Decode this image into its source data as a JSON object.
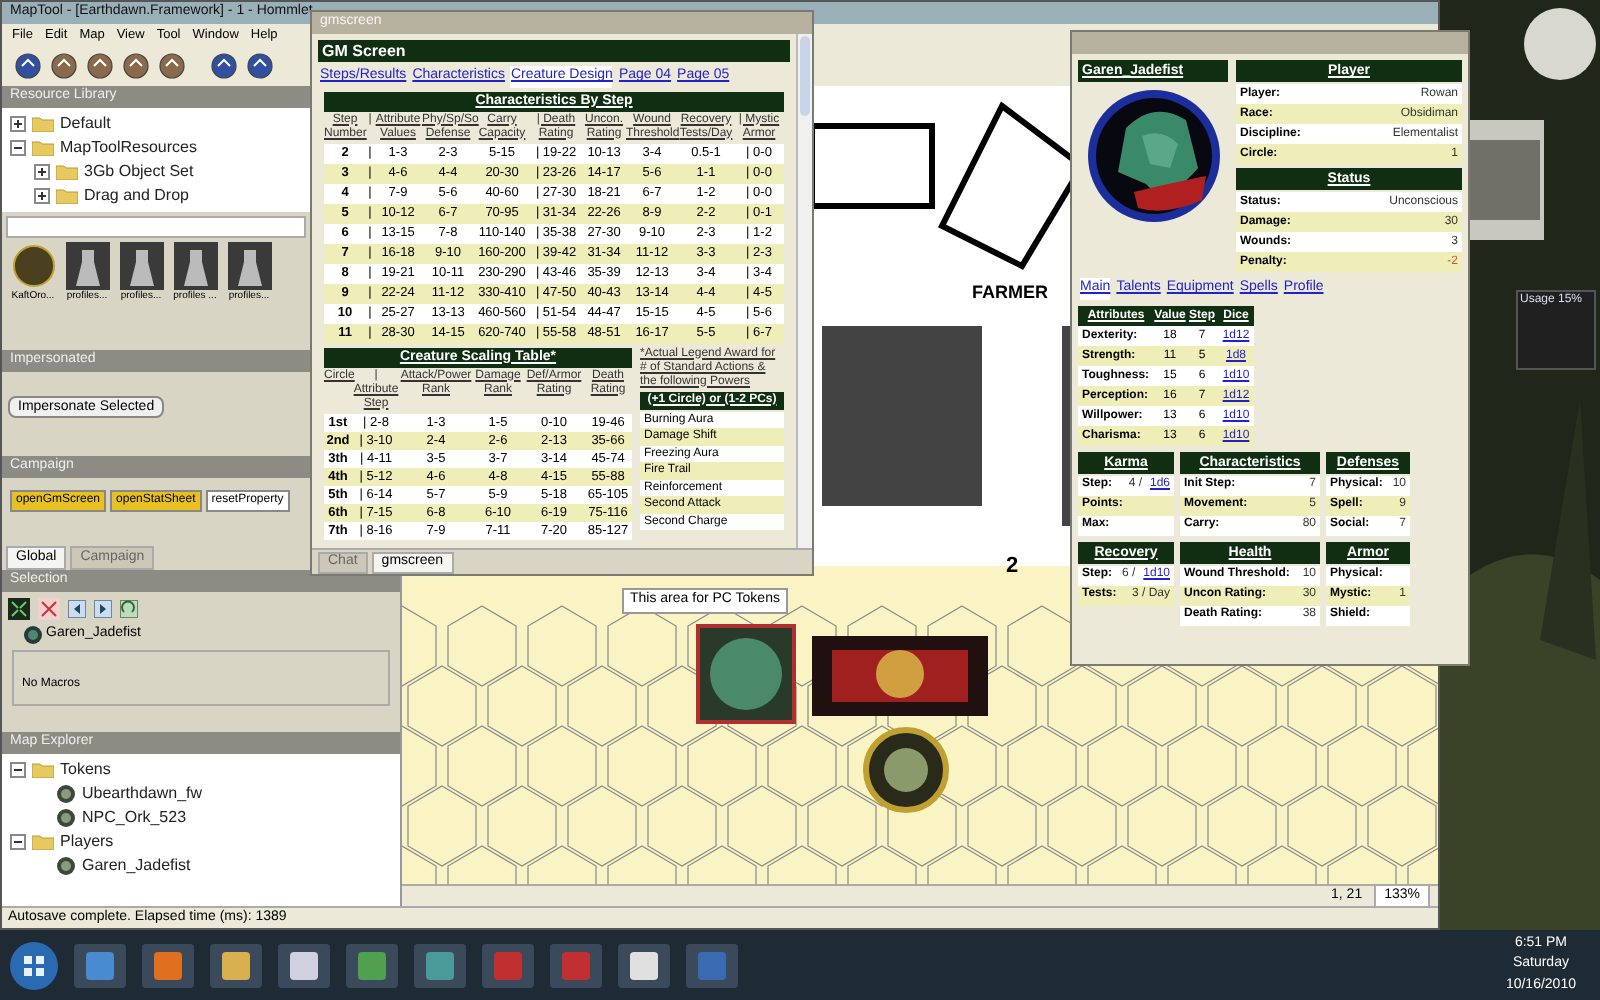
{
  "main_window": {
    "title": "MapTool - [Earthdawn.Framework] - 1 - Hommlet",
    "menu": [
      "File",
      "Edit",
      "Map",
      "View",
      "Tool",
      "Window",
      "Help"
    ]
  },
  "resource_library": {
    "title": "Resource Library",
    "tree": [
      {
        "label": "Default",
        "expanded": false
      },
      {
        "label": "MapToolResources",
        "expanded": true,
        "children": [
          {
            "label": "3Gb Object Set",
            "expanded": false
          },
          {
            "label": "Drag and Drop",
            "expanded": false
          }
        ]
      }
    ],
    "thumbnails": [
      "KaftOro...",
      "profiles...",
      "profiles...",
      "profiles ...",
      "profiles..."
    ]
  },
  "impersonated": {
    "title": "Impersonated",
    "button": "Impersonate Selected"
  },
  "campaign": {
    "title": "Campaign",
    "buttons": [
      {
        "label": "openGmScreen",
        "color": "#e8c020"
      },
      {
        "label": "openStatSheet",
        "color": "#e8c020"
      },
      {
        "label": "resetProperty",
        "color": "#ffffff"
      }
    ],
    "tabs": [
      {
        "label": "Global",
        "selected": true
      },
      {
        "label": "Campaign",
        "selected": false
      }
    ]
  },
  "selection": {
    "title": "Selection",
    "token": "Garen_Jadefist",
    "macros": "No Macros"
  },
  "map_explorer": {
    "title": "Map Explorer",
    "tree": [
      {
        "label": "Tokens",
        "expanded": true,
        "children": [
          {
            "label": "Ubearthdawn_fw"
          },
          {
            "label": "NPC_Ork_523"
          }
        ]
      },
      {
        "label": "Players",
        "expanded": true,
        "children": [
          {
            "label": "Garen_Jadefist"
          }
        ]
      }
    ]
  },
  "status_bar": "Autosave complete.  Elapsed time (ms): 1389",
  "map": {
    "labels": [
      "FARMER",
      "2"
    ],
    "area_label": "This area for PC Tokens",
    "coords": "1, 21",
    "zoom": "133%"
  },
  "gm_screen": {
    "title": "gmscreen",
    "header": "GM Screen",
    "links": [
      {
        "label": "Steps/Results",
        "selected": false
      },
      {
        "label": "Characteristics",
        "selected": false
      },
      {
        "label": "Creature Design",
        "selected": true
      },
      {
        "label": "Page 04",
        "selected": false
      },
      {
        "label": "Page 05",
        "selected": false
      }
    ],
    "step_table": {
      "title": "Characteristics By Step",
      "columns": [
        "Step Number",
        "|",
        "Attribute Values",
        "Phy/Sp/So Defense",
        "Carry Capacity",
        "| Death Rating",
        "Uncon. Rating",
        "Wound Threshold",
        "Recovery Tests/Day",
        "| Mystic Armor"
      ],
      "rows": [
        [
          "2",
          "|",
          "1-3",
          "2-3",
          "5-15",
          "| 19-22",
          "10-13",
          "3-4",
          "0.5-1",
          "| 0-0"
        ],
        [
          "3",
          "|",
          "4-6",
          "4-4",
          "20-30",
          "| 23-26",
          "14-17",
          "5-6",
          "1-1",
          "| 0-0"
        ],
        [
          "4",
          "|",
          "7-9",
          "5-6",
          "40-60",
          "| 27-30",
          "18-21",
          "6-7",
          "1-2",
          "| 0-0"
        ],
        [
          "5",
          "|",
          "10-12",
          "6-7",
          "70-95",
          "| 31-34",
          "22-26",
          "8-9",
          "2-2",
          "| 0-1"
        ],
        [
          "6",
          "|",
          "13-15",
          "7-8",
          "110-140",
          "| 35-38",
          "27-30",
          "9-10",
          "2-3",
          "| 1-2"
        ],
        [
          "7",
          "|",
          "16-18",
          "9-10",
          "160-200",
          "| 39-42",
          "31-34",
          "11-12",
          "3-3",
          "| 2-3"
        ],
        [
          "8",
          "|",
          "19-21",
          "10-11",
          "230-290",
          "| 43-46",
          "35-39",
          "12-13",
          "3-4",
          "| 3-4"
        ],
        [
          "9",
          "|",
          "22-24",
          "11-12",
          "330-410",
          "| 47-50",
          "40-43",
          "13-14",
          "4-4",
          "| 4-5"
        ],
        [
          "10",
          "|",
          "25-27",
          "13-13",
          "460-560",
          "| 51-54",
          "44-47",
          "15-15",
          "4-5",
          "| 5-6"
        ],
        [
          "11",
          "|",
          "28-30",
          "14-15",
          "620-740",
          "| 55-58",
          "48-51",
          "16-17",
          "5-5",
          "| 6-7"
        ]
      ]
    },
    "scaling_table": {
      "title": "Creature Scaling Table*",
      "columns": [
        "Circle",
        "| Attribute Step",
        "Attack/Power Rank",
        "Damage Rank",
        "Def/Armor Rating",
        "Death Rating"
      ],
      "rows": [
        [
          "1st",
          "| 2-8",
          "1-3",
          "1-5",
          "0-10",
          "19-46"
        ],
        [
          "2nd",
          "| 3-10",
          "2-4",
          "2-6",
          "2-13",
          "35-66"
        ],
        [
          "3th",
          "| 4-11",
          "3-5",
          "3-7",
          "3-14",
          "45-74"
        ],
        [
          "4th",
          "| 5-12",
          "4-6",
          "4-8",
          "4-15",
          "55-88"
        ],
        [
          "5th",
          "| 6-14",
          "5-7",
          "5-9",
          "5-18",
          "65-105"
        ],
        [
          "6th",
          "| 7-15",
          "6-8",
          "6-10",
          "6-19",
          "75-116"
        ],
        [
          "7th",
          "| 8-16",
          "7-9",
          "7-11",
          "7-20",
          "85-127"
        ]
      ]
    },
    "award_note": "*Actual Legend Award for # of Standard Actions & the following Powers",
    "powers_header": "(+1 Circle) or (1-2 PCs)",
    "powers": [
      "Burning Aura",
      "Damage Shift",
      "Freezing Aura",
      "Fire Trail",
      "Reinforcement",
      "Second Attack",
      "Second Charge"
    ],
    "tabs": [
      {
        "label": "Chat",
        "selected": false
      },
      {
        "label": "gmscreen",
        "selected": true
      }
    ]
  },
  "handout": {
    "name": "Garen_Jadefist",
    "player": {
      "title": "Player",
      "rows": [
        {
          "label": "Player:",
          "value": "Rowan"
        },
        {
          "label": "Race:",
          "value": "Obsidiman"
        },
        {
          "label": "Discipline:",
          "value": "Elementalist"
        },
        {
          "label": "Circle:",
          "value": "1"
        }
      ]
    },
    "status": {
      "title": "Status",
      "rows": [
        {
          "label": "Status:",
          "value": "Unconscious",
          "alert": false
        },
        {
          "label": "Damage:",
          "value": "30",
          "alert": false
        },
        {
          "label": "Wounds:",
          "value": "3",
          "alert": false
        },
        {
          "label": "Penalty:",
          "value": "-2",
          "alert": true
        }
      ]
    },
    "links": [
      {
        "label": "Main",
        "selected": true
      },
      {
        "label": "Talents",
        "selected": false
      },
      {
        "label": "Equipment",
        "selected": false
      },
      {
        "label": "Spells",
        "selected": false
      },
      {
        "label": "Profile",
        "selected": false
      }
    ],
    "attributes": {
      "columns": [
        "Attributes",
        "Value",
        "Step",
        "Dice"
      ],
      "rows": [
        [
          "Dexterity:",
          "18",
          "7",
          "1d12"
        ],
        [
          "Strength:",
          "11",
          "5",
          "1d8"
        ],
        [
          "Toughness:",
          "15",
          "6",
          "1d10"
        ],
        [
          "Perception:",
          "16",
          "7",
          "1d12"
        ],
        [
          "Willpower:",
          "13",
          "6",
          "1d10"
        ],
        [
          "Charisma:",
          "13",
          "6",
          "1d10"
        ]
      ]
    },
    "panels": [
      {
        "title": "Karma",
        "rows": [
          {
            "label": "Step:",
            "value": "4 /",
            "link": "1d6"
          },
          {
            "label": "Points:"
          },
          {
            "label": "Max:"
          }
        ]
      },
      {
        "title": "Characteristics",
        "rows": [
          {
            "label": "Init Step:",
            "value": "7"
          },
          {
            "label": "Movement:",
            "value": "5"
          },
          {
            "label": "Carry:",
            "value": "80"
          }
        ]
      },
      {
        "title": "Defenses",
        "rows": [
          {
            "label": "Physical:",
            "value": "10"
          },
          {
            "label": "Spell:",
            "value": "9"
          },
          {
            "label": "Social:",
            "value": "7"
          }
        ]
      },
      {
        "title": "Recovery",
        "rows": [
          {
            "label": "Step:",
            "value": "6 /",
            "link": "1d10"
          },
          {
            "label": "Tests:",
            "value": "3 / Day"
          }
        ]
      },
      {
        "title": "Health",
        "rows": [
          {
            "label": "Wound Threshold:",
            "value": "10"
          },
          {
            "label": "Uncon Rating:",
            "value": "30"
          },
          {
            "label": "Death Rating:",
            "value": "38"
          }
        ]
      },
      {
        "title": "Armor",
        "rows": [
          {
            "label": "Physical:"
          },
          {
            "label": "Mystic:",
            "value": "1"
          },
          {
            "label": "Shield:"
          }
        ]
      }
    ]
  },
  "desktop": {
    "gadget": "Usage 15%"
  },
  "taskbar": {
    "time": "6:51 PM",
    "day": "Saturday",
    "date": "10/16/2010"
  }
}
